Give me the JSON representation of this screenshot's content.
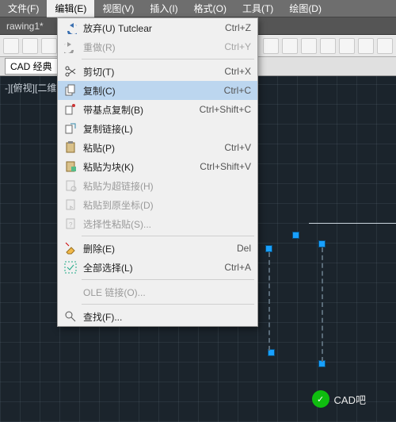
{
  "menubar": {
    "items": [
      {
        "label": "文件(F)"
      },
      {
        "label": "编辑(E)",
        "open": true
      },
      {
        "label": "视图(V)"
      },
      {
        "label": "插入(I)"
      },
      {
        "label": "格式(O)"
      },
      {
        "label": "工具(T)"
      },
      {
        "label": "绘图(D)"
      }
    ]
  },
  "title_tab": "rawing1*",
  "workspace_label": "CAD 经典",
  "viewport_label": "-][俯视][二维",
  "edit_menu": [
    {
      "type": "item",
      "label": "放弃(U)  Tutclear",
      "shortcut": "Ctrl+Z",
      "icon": "undo-icon",
      "interact": true
    },
    {
      "type": "item",
      "label": "重做(R)",
      "shortcut": "Ctrl+Y",
      "icon": "redo-icon",
      "interact": false,
      "disabled": true
    },
    {
      "type": "sep"
    },
    {
      "type": "item",
      "label": "剪切(T)",
      "shortcut": "Ctrl+X",
      "icon": "scissors-icon",
      "interact": true
    },
    {
      "type": "item",
      "label": "复制(C)",
      "shortcut": "Ctrl+C",
      "icon": "copy-icon",
      "interact": true,
      "highlight": true
    },
    {
      "type": "item",
      "label": "带基点复制(B)",
      "shortcut": "Ctrl+Shift+C",
      "icon": "copy-base-icon",
      "interact": true
    },
    {
      "type": "item",
      "label": "复制链接(L)",
      "shortcut": "",
      "icon": "copy-link-icon",
      "interact": true
    },
    {
      "type": "item",
      "label": "粘贴(P)",
      "shortcut": "Ctrl+V",
      "icon": "paste-icon",
      "interact": true
    },
    {
      "type": "item",
      "label": "粘贴为块(K)",
      "shortcut": "Ctrl+Shift+V",
      "icon": "paste-block-icon",
      "interact": true
    },
    {
      "type": "item",
      "label": "粘贴为超链接(H)",
      "shortcut": "",
      "icon": "paste-hyperlink-icon",
      "interact": false,
      "disabled": true
    },
    {
      "type": "item",
      "label": "粘贴到原坐标(D)",
      "shortcut": "",
      "icon": "paste-orig-icon",
      "interact": false,
      "disabled": true
    },
    {
      "type": "item",
      "label": "选择性粘贴(S)...",
      "shortcut": "",
      "icon": "paste-special-icon",
      "interact": false,
      "disabled": true
    },
    {
      "type": "sep"
    },
    {
      "type": "item",
      "label": "删除(E)",
      "shortcut": "Del",
      "icon": "erase-icon",
      "interact": true
    },
    {
      "type": "item",
      "label": "全部选择(L)",
      "shortcut": "Ctrl+A",
      "icon": "select-all-icon",
      "interact": true
    },
    {
      "type": "sep"
    },
    {
      "type": "item",
      "label": "OLE 链接(O)...",
      "shortcut": "",
      "icon": "",
      "interact": false,
      "disabled": true
    },
    {
      "type": "sep"
    },
    {
      "type": "item",
      "label": "查找(F)...",
      "shortcut": "",
      "icon": "find-icon",
      "interact": true
    }
  ],
  "watermark_text": "CAD吧",
  "colors": {
    "highlight": "#bcd6ef",
    "grip": "#18a0ff",
    "canvas": "#1b242c"
  }
}
